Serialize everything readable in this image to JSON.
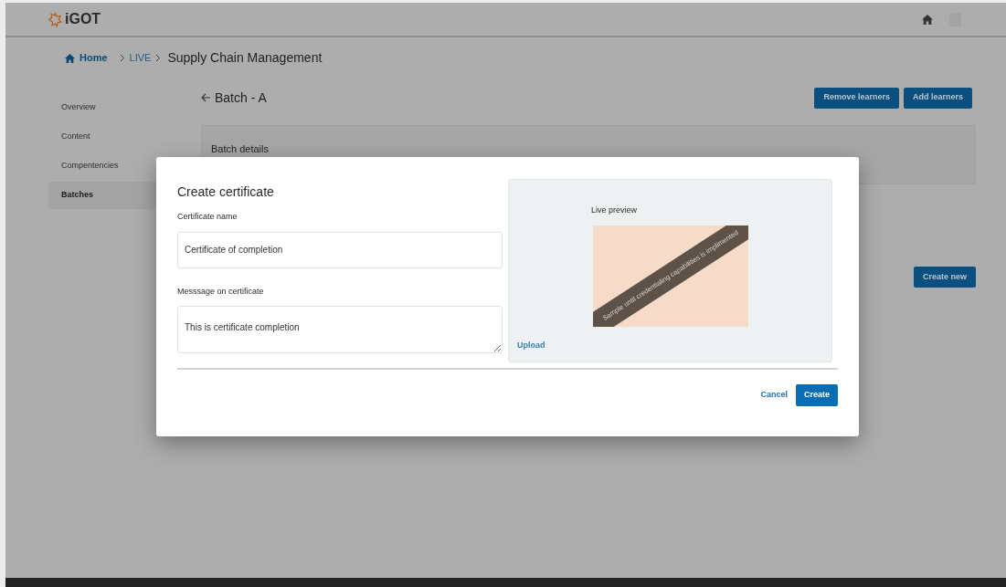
{
  "header": {
    "logo": "iGOT"
  },
  "breadcrumb": [
    {
      "kind": "home",
      "label": "Home"
    },
    {
      "kind": "link",
      "label": "LIVE"
    },
    {
      "kind": "current",
      "label": "Supply Chain Management"
    }
  ],
  "sidebar": {
    "items": [
      {
        "label": "Overview",
        "selected": false
      },
      {
        "label": "Content",
        "selected": false
      },
      {
        "label": "Compentencies",
        "selected": false
      },
      {
        "label": "Batches",
        "selected": true
      }
    ]
  },
  "page": {
    "title": "Batch - A",
    "actions": [
      "Remove learners",
      "Add learners"
    ],
    "section_title": "Batch details",
    "create_button": "Create new"
  },
  "dialog": {
    "title": "Create certificate",
    "fields": [
      {
        "kind": "input",
        "label": "Certificate name",
        "value": "Certificate of completion"
      },
      {
        "kind": "textarea",
        "label": "Messsage on certificate",
        "value": "This is certificate completion"
      }
    ],
    "preview": {
      "title": "Live preview",
      "ribbon": "Sample until credentialing capabilities is implimented",
      "upload": "Upload"
    },
    "cancel": "Cancel",
    "confirm": "Create"
  }
}
